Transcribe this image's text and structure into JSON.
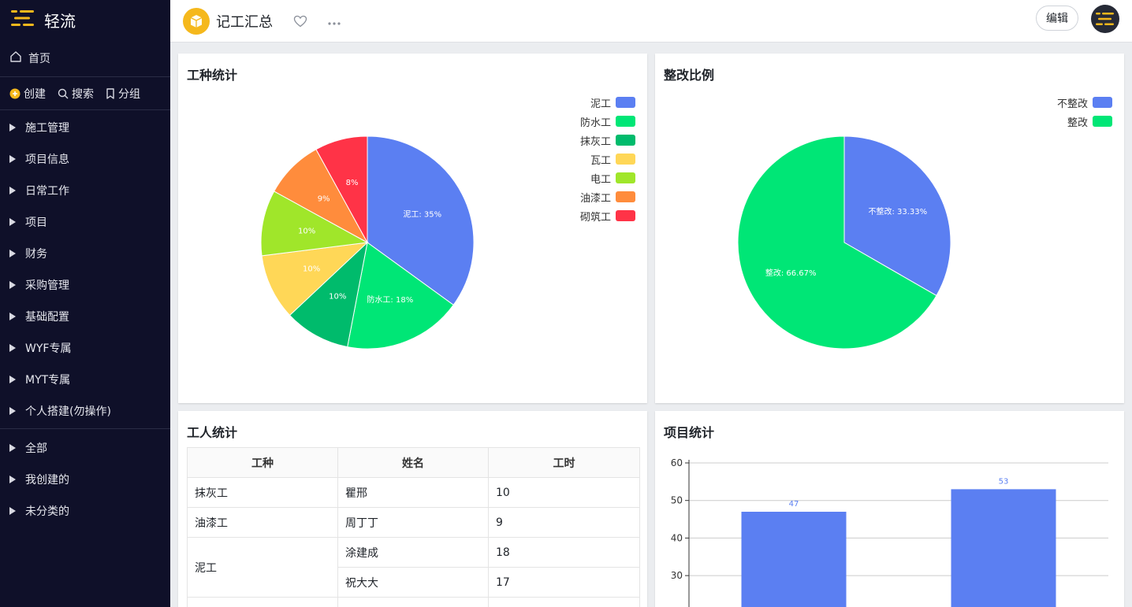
{
  "sidebar": {
    "brand": "轻流",
    "home": "首页",
    "actions": {
      "create": "创建",
      "search": "搜索",
      "group": "分组"
    },
    "groups": [
      "施工管理",
      "项目信息",
      "日常工作",
      "项目",
      "财务",
      "采购管理",
      "基础配置",
      "WYF专属",
      "MYT专属",
      "个人搭建(勿操作)"
    ],
    "filters": [
      "全部",
      "我创建的",
      "未分类的"
    ]
  },
  "topbar": {
    "title": "记工汇总",
    "edit_label": "编辑"
  },
  "colors": {
    "brand_accent": "#f5b81c",
    "sidebar_bg": "#0f1029",
    "blue": "#5b7ff2",
    "green": "#00e676"
  },
  "cards": {
    "trade": {
      "title": "工种统计",
      "legend": [
        "泥工",
        "防水工",
        "抹灰工",
        "瓦工",
        "电工",
        "油漆工",
        "砌筑工"
      ]
    },
    "rectify": {
      "title": "整改比例",
      "legend": [
        "不整改",
        "整改"
      ]
    },
    "workers": {
      "title": "工人统计",
      "headers": [
        "工种",
        "姓名",
        "工时"
      ],
      "rows": [
        {
          "trade": "抹灰工",
          "name": "瞿邢",
          "hours": "10"
        },
        {
          "trade": "油漆工",
          "name": "周丁丁",
          "hours": "9"
        },
        {
          "trade": "泥工",
          "name": "涂建成",
          "hours": "18"
        },
        {
          "trade": "",
          "name": "祝大大",
          "hours": "17"
        }
      ]
    },
    "projects": {
      "title": "项目统计"
    }
  },
  "chart_data": [
    {
      "type": "pie",
      "title": "工种统计",
      "labels": [
        "泥工",
        "防水工",
        "抹灰工",
        "瓦工",
        "电工",
        "油漆工",
        "砌筑工"
      ],
      "values": [
        35,
        18,
        10,
        10,
        10,
        9,
        8
      ],
      "slice_labels": [
        "泥工: 35%",
        "防水工: 18%",
        "10%",
        "10%",
        "10%",
        "9%",
        "8%"
      ],
      "colors": [
        "#5b7ff2",
        "#00e676",
        "#00bb6c",
        "#ffd757",
        "#a0e62a",
        "#ff8c3c",
        "#ff3347"
      ],
      "legend": "top-right"
    },
    {
      "type": "pie",
      "title": "整改比例",
      "labels": [
        "不整改",
        "整改"
      ],
      "values": [
        33.33,
        66.67
      ],
      "slice_labels": [
        "不整改: 33.33%",
        "整改: 66.67%"
      ],
      "colors": [
        "#5b7ff2",
        "#00e676"
      ],
      "legend": "top-right"
    },
    {
      "type": "bar",
      "title": "项目统计",
      "categories": [
        "",
        ""
      ],
      "values": [
        47,
        53
      ],
      "value_labels": [
        "47",
        "53"
      ],
      "yticks": [
        "60",
        "50",
        "40",
        "30"
      ],
      "ylim": [
        0,
        60
      ],
      "grid": true,
      "color": "#5b7ff2"
    }
  ]
}
